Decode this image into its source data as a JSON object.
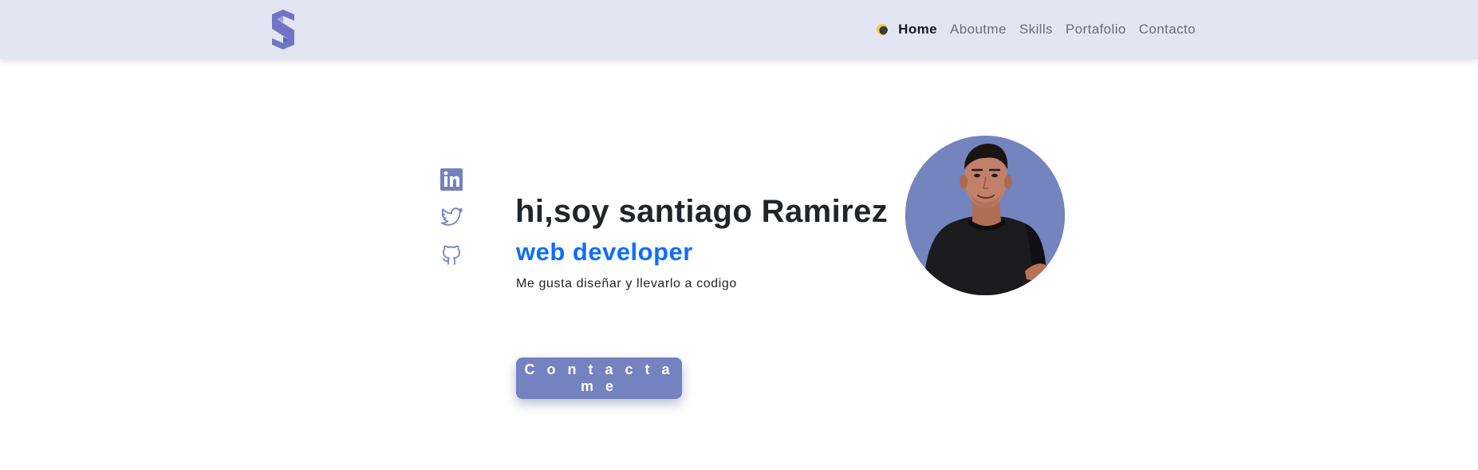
{
  "nav": {
    "brand_logo": "s-logo-icon",
    "theme_toggle_icon": "moon-toggle-icon",
    "links": [
      {
        "label": "Home",
        "active": true
      },
      {
        "label": "Aboutme",
        "active": false
      },
      {
        "label": "Skills",
        "active": false
      },
      {
        "label": "Portafolio",
        "active": false
      },
      {
        "label": "Contacto",
        "active": false
      }
    ]
  },
  "social": [
    {
      "icon": "linkedin-icon"
    },
    {
      "icon": "twitter-icon"
    },
    {
      "icon": "github-icon"
    }
  ],
  "hero": {
    "title": "hi,soy santiago Ramirez",
    "subtitle": "web developer",
    "description": "Me gusta diseñar y llevarlo a codigo",
    "cta_label": "C o n t a c t a m e"
  },
  "profile_photo": {
    "icon": "profile-photo"
  },
  "colors": {
    "navbar_bg": "#e2e6f3",
    "accent": "#7482bf",
    "subtitle_blue": "#0d6efd",
    "text": "#212529"
  }
}
